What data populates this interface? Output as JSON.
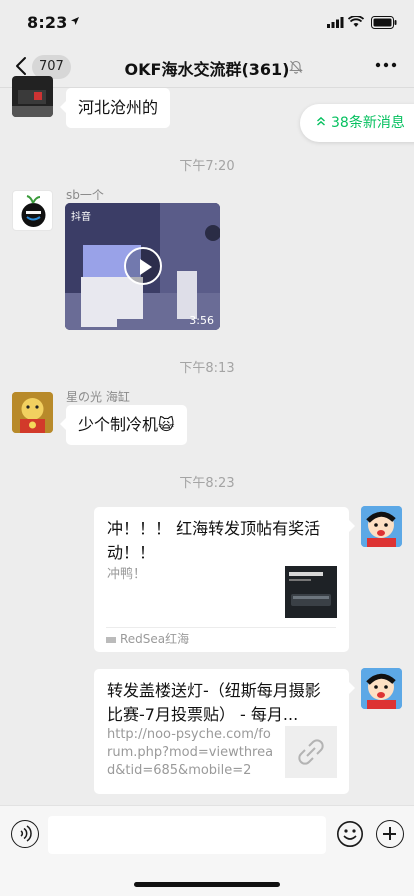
{
  "status_bar": {
    "time": "8:23"
  },
  "header": {
    "back_count": "707",
    "title": "OKF海水交流群(361)"
  },
  "new_messages": {
    "label": "38条新消息"
  },
  "messages": [
    {
      "type": "text",
      "text": "河北沧州的"
    },
    {
      "type": "time",
      "text": "下午7:20"
    },
    {
      "type": "video",
      "sender": "sb一个",
      "platform": "抖音",
      "duration": "3:56"
    },
    {
      "type": "time",
      "text": "下午8:13"
    },
    {
      "type": "text",
      "sender": "星の光  海缸",
      "text": "少个制冷机🙀"
    },
    {
      "type": "time",
      "text": "下午8:23"
    },
    {
      "type": "link_card",
      "title": "冲！！！ 红海转发顶帖有奖活动！！",
      "desc": "冲鸭！",
      "source": "RedSea红海"
    },
    {
      "type": "link_card",
      "title": "转发盖楼送灯-（纽斯每月摄影比赛-7月投票贴） - 每月...",
      "desc": "http://noo-psyche.com/forum.php?mod=viewthread&tid=685&mobile=2"
    }
  ],
  "colors": {
    "accent": "#07c160",
    "background": "#ededed"
  },
  "icons": [
    "back-icon",
    "mute-icon",
    "more-icon",
    "up-arrow-icon",
    "play-icon",
    "link-icon",
    "voice-icon",
    "emoji-icon",
    "plus-icon"
  ]
}
